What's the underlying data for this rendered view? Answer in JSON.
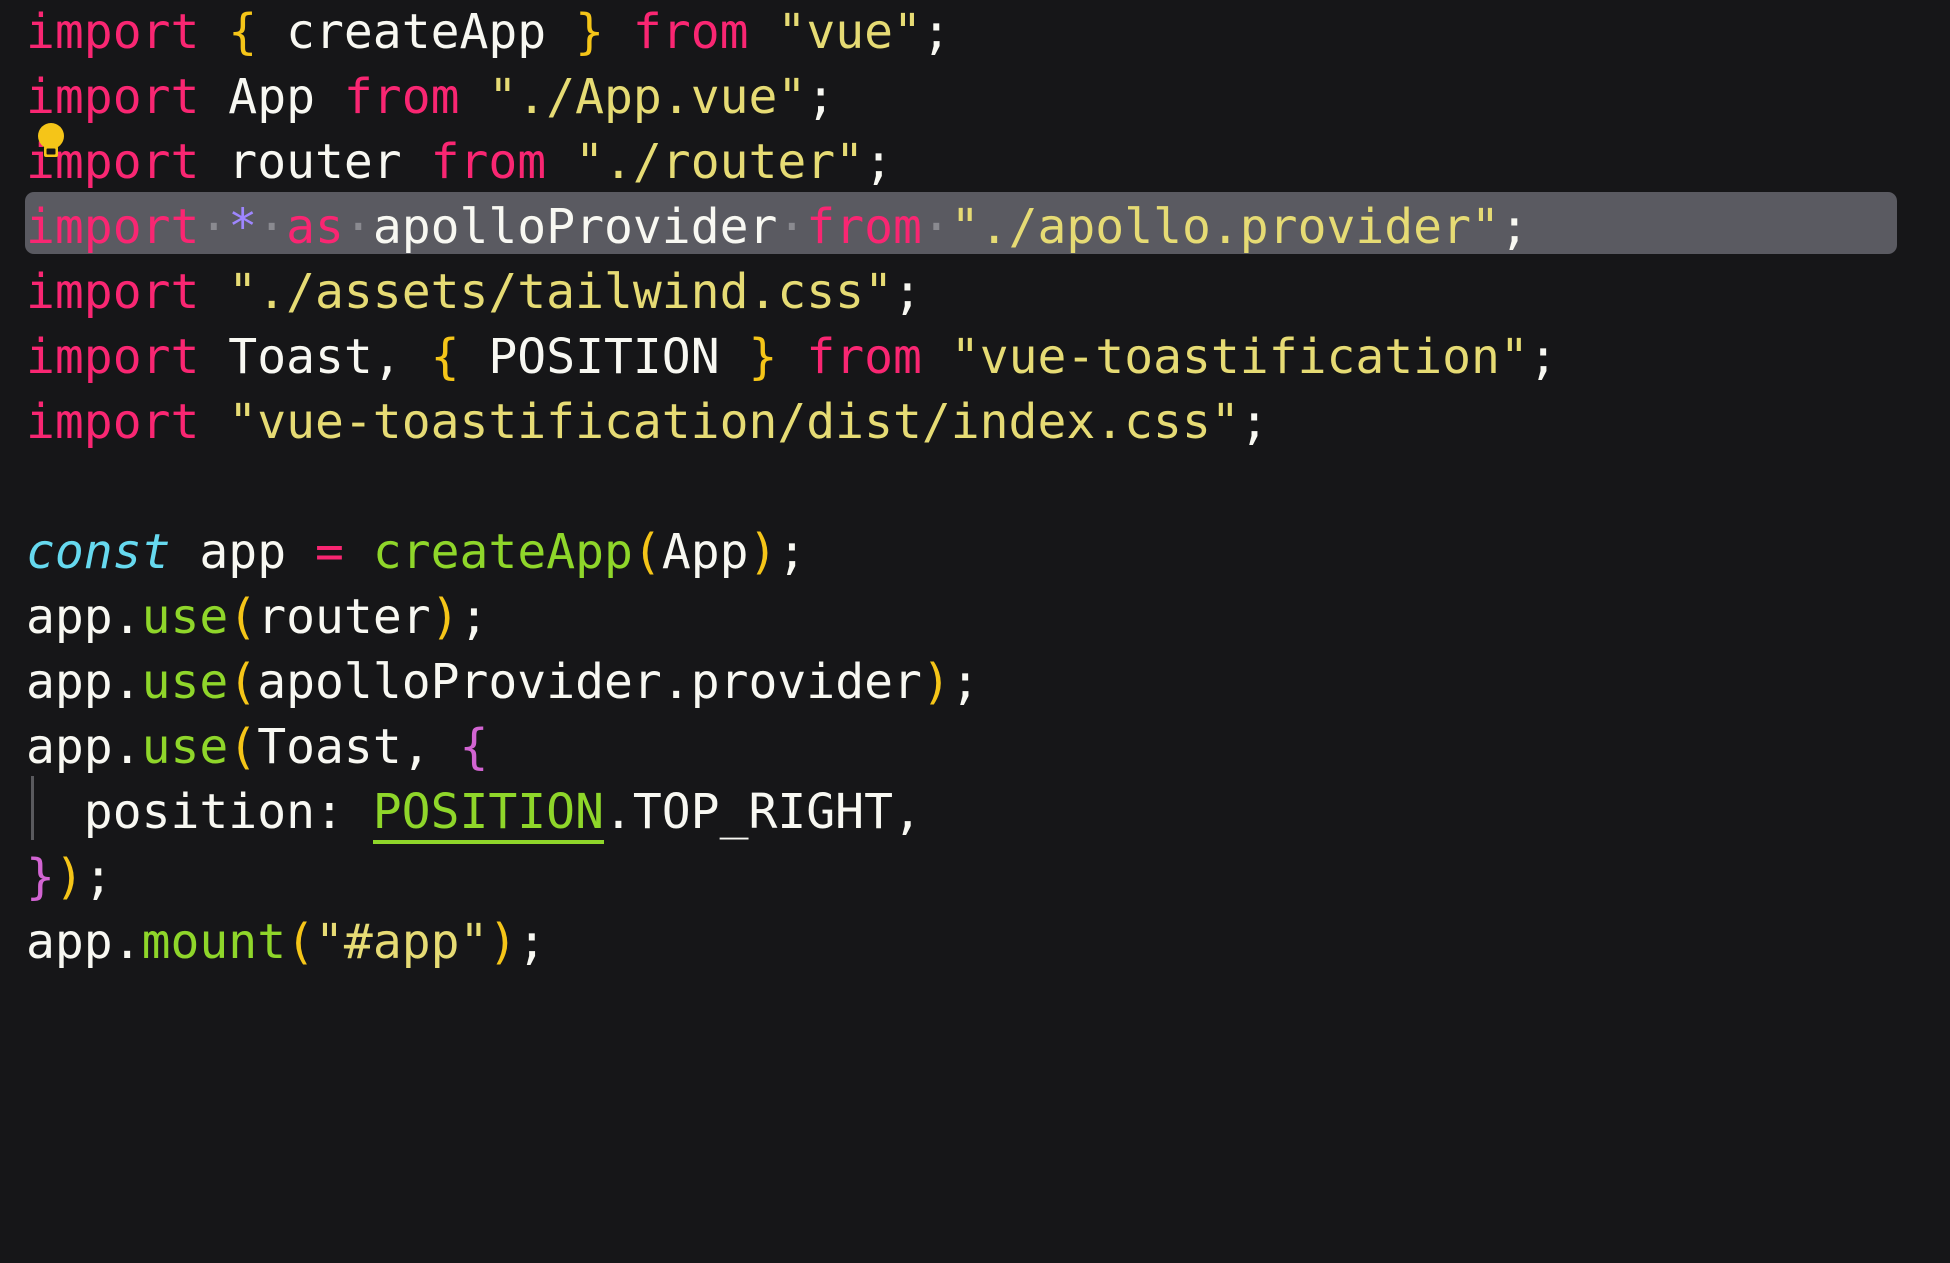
{
  "editor": {
    "language": "javascript",
    "background_color": "#161618",
    "font_size_px": 48,
    "line_height_px": 65,
    "selection_color": "#5a5a61",
    "colors": {
      "keyword": "#f92672",
      "string": "#e6db74",
      "identifier": "#f8f8f2",
      "function": "#8fd62a",
      "const_keyword": "#66d9ef",
      "brace_yellow": "#f5c518",
      "brace_magenta": "#d264d2",
      "glob_star": "#9e86ff",
      "indent_guide": "#5a5a5e",
      "lightbulb": "#f5c518"
    }
  },
  "quick_fix": {
    "icon": "lightbulb-icon",
    "line_number": 3
  },
  "indent_guide": {
    "line_number": 12
  },
  "selection": {
    "line_number": 4,
    "text": "import * as apolloProvider from \"./apollo.provider\";"
  },
  "code": {
    "lines": [
      {
        "n": 1,
        "text": "import { createApp } from \"vue\";",
        "tokens": [
          {
            "t": "import",
            "c": "kw"
          },
          {
            "t": " ",
            "c": "punc"
          },
          {
            "t": "{",
            "c": "brace"
          },
          {
            "t": " ",
            "c": "punc"
          },
          {
            "t": "createApp",
            "c": "ident"
          },
          {
            "t": " ",
            "c": "punc"
          },
          {
            "t": "}",
            "c": "brace"
          },
          {
            "t": " ",
            "c": "punc"
          },
          {
            "t": "from",
            "c": "kw"
          },
          {
            "t": " ",
            "c": "punc"
          },
          {
            "t": "\"vue\"",
            "c": "str"
          },
          {
            "t": ";",
            "c": "punc"
          }
        ]
      },
      {
        "n": 2,
        "text": "import App from \"./App.vue\";",
        "tokens": [
          {
            "t": "import",
            "c": "kw"
          },
          {
            "t": " ",
            "c": "punc"
          },
          {
            "t": "App",
            "c": "ident"
          },
          {
            "t": " ",
            "c": "punc"
          },
          {
            "t": "from",
            "c": "kw"
          },
          {
            "t": " ",
            "c": "punc"
          },
          {
            "t": "\"./App.vue\"",
            "c": "str"
          },
          {
            "t": ";",
            "c": "punc"
          }
        ]
      },
      {
        "n": 3,
        "text": "import router from \"./router\";",
        "tokens": [
          {
            "t": "import",
            "c": "kw"
          },
          {
            "t": " ",
            "c": "punc"
          },
          {
            "t": "router",
            "c": "ident"
          },
          {
            "t": " ",
            "c": "punc"
          },
          {
            "t": "from",
            "c": "kw"
          },
          {
            "t": " ",
            "c": "punc"
          },
          {
            "t": "\"./router\"",
            "c": "str"
          },
          {
            "t": ";",
            "c": "punc"
          }
        ]
      },
      {
        "n": 4,
        "text": "import * as apolloProvider from \"./apollo.provider\";",
        "selected": true,
        "tokens": [
          {
            "t": "import",
            "c": "kw"
          },
          {
            "t": "·",
            "c": "ws"
          },
          {
            "t": "*",
            "c": "star"
          },
          {
            "t": "·",
            "c": "ws"
          },
          {
            "t": "as",
            "c": "kw"
          },
          {
            "t": "·",
            "c": "ws"
          },
          {
            "t": "apolloProvider",
            "c": "ident"
          },
          {
            "t": "·",
            "c": "ws"
          },
          {
            "t": "from",
            "c": "kw"
          },
          {
            "t": "·",
            "c": "ws"
          },
          {
            "t": "\"./apollo.provider\"",
            "c": "str"
          },
          {
            "t": ";",
            "c": "punc"
          }
        ]
      },
      {
        "n": 5,
        "text": "import \"./assets/tailwind.css\";",
        "tokens": [
          {
            "t": "import",
            "c": "kw"
          },
          {
            "t": " ",
            "c": "punc"
          },
          {
            "t": "\"./assets/tailwind.css\"",
            "c": "str"
          },
          {
            "t": ";",
            "c": "punc"
          }
        ]
      },
      {
        "n": 6,
        "text": "import Toast, { POSITION } from \"vue-toastification\";",
        "tokens": [
          {
            "t": "import",
            "c": "kw"
          },
          {
            "t": " ",
            "c": "punc"
          },
          {
            "t": "Toast",
            "c": "ident"
          },
          {
            "t": ", ",
            "c": "punc"
          },
          {
            "t": "{",
            "c": "brace"
          },
          {
            "t": " ",
            "c": "punc"
          },
          {
            "t": "POSITION",
            "c": "ident"
          },
          {
            "t": " ",
            "c": "punc"
          },
          {
            "t": "}",
            "c": "brace"
          },
          {
            "t": " ",
            "c": "punc"
          },
          {
            "t": "from",
            "c": "kw"
          },
          {
            "t": " ",
            "c": "punc"
          },
          {
            "t": "\"vue-toastification\"",
            "c": "str"
          },
          {
            "t": ";",
            "c": "punc"
          }
        ]
      },
      {
        "n": 7,
        "text": "import \"vue-toastification/dist/index.css\";",
        "tokens": [
          {
            "t": "import",
            "c": "kw"
          },
          {
            "t": " ",
            "c": "punc"
          },
          {
            "t": "\"vue-toastification/dist/index.css\"",
            "c": "str"
          },
          {
            "t": ";",
            "c": "punc"
          }
        ]
      },
      {
        "n": 8,
        "text": "",
        "tokens": []
      },
      {
        "n": 9,
        "text": "const app = createApp(App);",
        "tokens": [
          {
            "t": "const",
            "c": "const-kw"
          },
          {
            "t": " ",
            "c": "punc"
          },
          {
            "t": "app",
            "c": "ident"
          },
          {
            "t": " ",
            "c": "punc"
          },
          {
            "t": "=",
            "c": "op"
          },
          {
            "t": " ",
            "c": "punc"
          },
          {
            "t": "createApp",
            "c": "fn"
          },
          {
            "t": "(",
            "c": "paren"
          },
          {
            "t": "App",
            "c": "ident"
          },
          {
            "t": ")",
            "c": "paren"
          },
          {
            "t": ";",
            "c": "punc"
          }
        ]
      },
      {
        "n": 10,
        "text": "app.use(router);",
        "tokens": [
          {
            "t": "app",
            "c": "ident"
          },
          {
            "t": ".",
            "c": "punc"
          },
          {
            "t": "use",
            "c": "fn"
          },
          {
            "t": "(",
            "c": "paren"
          },
          {
            "t": "router",
            "c": "ident"
          },
          {
            "t": ")",
            "c": "paren"
          },
          {
            "t": ";",
            "c": "punc"
          }
        ]
      },
      {
        "n": 11,
        "text": "app.use(apolloProvider.provider);",
        "tokens": [
          {
            "t": "app",
            "c": "ident"
          },
          {
            "t": ".",
            "c": "punc"
          },
          {
            "t": "use",
            "c": "fn"
          },
          {
            "t": "(",
            "c": "paren"
          },
          {
            "t": "apolloProvider",
            "c": "ident"
          },
          {
            "t": ".",
            "c": "punc"
          },
          {
            "t": "provider",
            "c": "ident"
          },
          {
            "t": ")",
            "c": "paren"
          },
          {
            "t": ";",
            "c": "punc"
          }
        ]
      },
      {
        "n": 12,
        "text": "app.use(Toast, {",
        "tokens": [
          {
            "t": "app",
            "c": "ident"
          },
          {
            "t": ".",
            "c": "punc"
          },
          {
            "t": "use",
            "c": "fn"
          },
          {
            "t": "(",
            "c": "paren"
          },
          {
            "t": "Toast",
            "c": "ident"
          },
          {
            "t": ", ",
            "c": "punc"
          },
          {
            "t": "{",
            "c": "brace-m"
          }
        ]
      },
      {
        "n": 13,
        "text": "  position: POSITION.TOP_RIGHT,",
        "tokens": [
          {
            "t": "  ",
            "c": "punc"
          },
          {
            "t": "position",
            "c": "ident"
          },
          {
            "t": ": ",
            "c": "punc"
          },
          {
            "t": "POSITION",
            "c": "link"
          },
          {
            "t": ".",
            "c": "punc"
          },
          {
            "t": "TOP_RIGHT",
            "c": "ident"
          },
          {
            "t": ",",
            "c": "punc"
          }
        ]
      },
      {
        "n": 14,
        "text": "});",
        "tokens": [
          {
            "t": "}",
            "c": "brace-m"
          },
          {
            "t": ")",
            "c": "paren"
          },
          {
            "t": ";",
            "c": "punc"
          }
        ]
      },
      {
        "n": 15,
        "text": "app.mount(\"#app\");",
        "tokens": [
          {
            "t": "app",
            "c": "ident"
          },
          {
            "t": ".",
            "c": "punc"
          },
          {
            "t": "mount",
            "c": "fn"
          },
          {
            "t": "(",
            "c": "paren"
          },
          {
            "t": "\"#app\"",
            "c": "str"
          },
          {
            "t": ")",
            "c": "paren"
          },
          {
            "t": ";",
            "c": "punc"
          }
        ]
      }
    ]
  }
}
